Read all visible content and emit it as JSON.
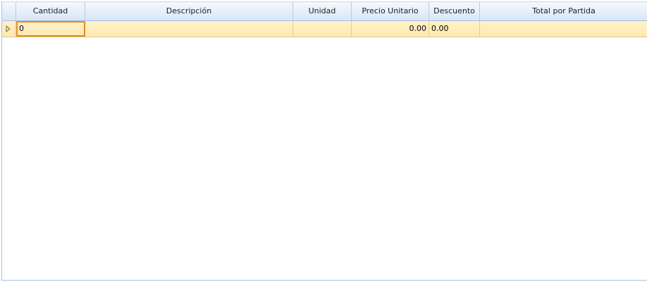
{
  "grid": {
    "columns": [
      {
        "key": "cantidad",
        "label": "Cantidad"
      },
      {
        "key": "descripcion",
        "label": "Descripción"
      },
      {
        "key": "unidad",
        "label": "Unidad"
      },
      {
        "key": "precio_unitario",
        "label": "Precio Unitario"
      },
      {
        "key": "descuento",
        "label": "Descuento"
      },
      {
        "key": "total_por_partida",
        "label": "Total por Partida"
      }
    ],
    "rows": [
      {
        "cantidad": "0",
        "descripcion": "",
        "unidad": "",
        "precio_unitario": "0.00",
        "descuento": "0.00",
        "total_por_partida": ""
      }
    ]
  },
  "icons": {
    "row_indicator": "current-row-arrow-icon"
  },
  "colors": {
    "header_bg": "#dfe9f6",
    "selected_row_bg": "#ffeebd",
    "editing_border": "#e68a1f",
    "grid_border": "#a7c0e0"
  }
}
